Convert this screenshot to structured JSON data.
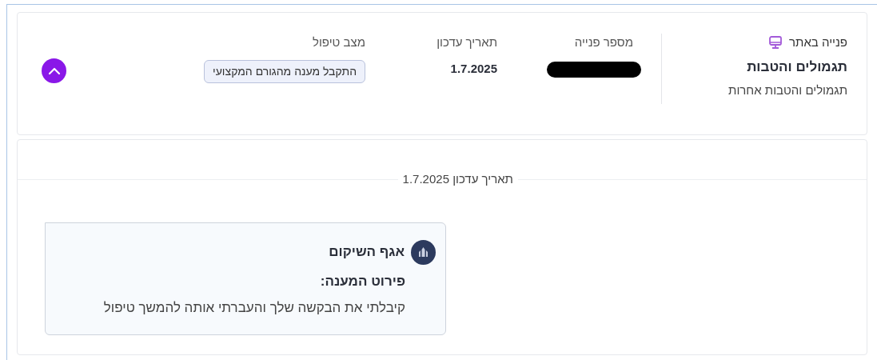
{
  "request": {
    "channel": "פנייה באתר",
    "title": "תגמולים והטבות",
    "subtitle": "תגמולים והטבות אחרות",
    "fields": [
      {
        "kind": "redacted",
        "label": "מספר פנייה"
      },
      {
        "kind": "text",
        "label": "תאריך עדכון",
        "value": "1.7.2025"
      },
      {
        "kind": "badge",
        "label": "מצב טיפול",
        "value": "התקבל מענה מהגורם המקצועי"
      }
    ],
    "expanded": true
  },
  "timeline": {
    "date_label": "תאריך עדכון 1.7.2025",
    "messages": [
      {
        "sender": "אגף השיקום",
        "heading": "פירוט המענה:",
        "body": "קיבלתי את הבקשה שלך והעברתי אותה להמשך טיפול"
      }
    ]
  }
}
